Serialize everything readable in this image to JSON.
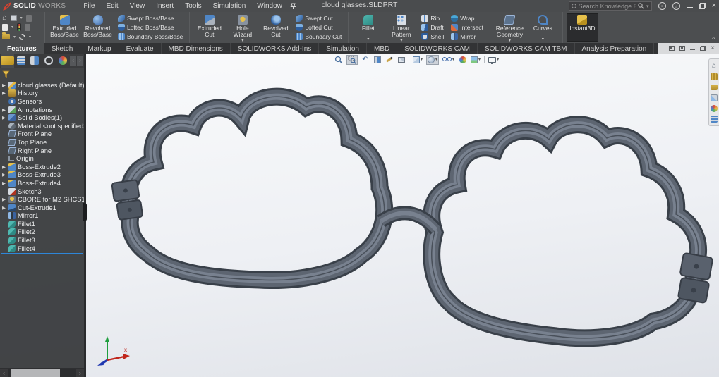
{
  "titlebar": {
    "brand": {
      "bold": "SOLID",
      "light": "WORKS",
      "logo_icon": "dassault-compass-icon"
    },
    "menus": [
      {
        "label": "File"
      },
      {
        "label": "Edit"
      },
      {
        "label": "View"
      },
      {
        "label": "Insert"
      },
      {
        "label": "Tools"
      },
      {
        "label": "Simulation"
      },
      {
        "label": "Window"
      }
    ],
    "pin_icon": "pin-icon",
    "document_title": "cloud glasses.SLDPRT",
    "search": {
      "placeholder": "Search Knowledge Base",
      "icons": [
        "knowledge-base-icon",
        "search-icon",
        "chevron-down-icon"
      ]
    },
    "window_icons": [
      "user-account-icon",
      "help-icon",
      "minimize-icon",
      "restore-icon",
      "close-icon"
    ],
    "help_glyph": "?"
  },
  "quick_access": {
    "icons": [
      "home-icon",
      "save-icon",
      "undo-icon",
      "redo-icon",
      "new-document-icon",
      "rebuild-icon",
      "open-document-icon",
      "options-icon"
    ]
  },
  "ribbon": {
    "collapse_glyph": "^",
    "groups": {
      "features_boss": {
        "big": [
          {
            "label": "Extruded Boss/Base",
            "icon": "b-boss"
          },
          {
            "label": "Revolved Boss/Base",
            "icon": "b-rev"
          }
        ],
        "small": [
          {
            "label": "Swept Boss/Base",
            "icon": "b-swept"
          },
          {
            "label": "Lofted Boss/Base",
            "icon": "b-loft"
          },
          {
            "label": "Boundary Boss/Base",
            "icon": "b-bound"
          }
        ]
      },
      "features_cut": {
        "big": [
          {
            "label": "Extruded Cut",
            "icon": "c-ext"
          },
          {
            "label": "Hole Wizard",
            "icon": "c-hole",
            "caret": "▾"
          },
          {
            "label": "Revolved Cut",
            "icon": "c-rev"
          }
        ],
        "small": [
          {
            "label": "Swept Cut",
            "icon": "b-swept"
          },
          {
            "label": "Lofted Cut",
            "icon": "b-loft"
          },
          {
            "label": "Boundary Cut",
            "icon": "b-bound"
          }
        ]
      },
      "modify": {
        "big": [
          {
            "label": "Fillet",
            "icon": "m-fil",
            "caret": "▾"
          },
          {
            "label": "Linear Pattern",
            "icon": "m-lp",
            "caret": "▾"
          }
        ],
        "small1": [
          {
            "label": "Rib",
            "icon": "m-rib"
          },
          {
            "label": "Draft",
            "icon": "m-draft"
          },
          {
            "label": "Shell",
            "icon": "m-shell"
          }
        ],
        "small2": [
          {
            "label": "Wrap",
            "icon": "m-wrap"
          },
          {
            "label": "Intersect",
            "icon": "m-int"
          },
          {
            "label": "Mirror",
            "icon": "m-mir"
          }
        ]
      },
      "reference": {
        "big": [
          {
            "label": "Reference Geometry",
            "icon": "r-ref",
            "caret": "▾"
          },
          {
            "label": "Curves",
            "icon": "r-crv",
            "caret": "▾"
          }
        ]
      },
      "instant3d": {
        "big": [
          {
            "label": "Instant3D",
            "icon": "i3d",
            "active": true
          }
        ]
      }
    }
  },
  "tabs": {
    "items": [
      {
        "label": "Features",
        "active": true
      },
      {
        "label": "Sketch"
      },
      {
        "label": "Markup"
      },
      {
        "label": "Evaluate"
      },
      {
        "label": "MBD Dimensions"
      },
      {
        "label": "SOLIDWORKS Add-Ins"
      },
      {
        "label": "Simulation"
      },
      {
        "label": "MBD"
      },
      {
        "label": "SOLIDWORKS CAM"
      },
      {
        "label": "SOLIDWORKS CAM TBM"
      },
      {
        "label": "Analysis Preparation"
      }
    ],
    "document_controls": [
      "cascade-icon",
      "tile-icon",
      "minimize-icon",
      "restore-icon",
      "close-icon"
    ]
  },
  "headsup": {
    "icons": [
      "zoom-to-fit-icon",
      "zoom-to-area-icon",
      "previous-view-icon",
      "section-view-icon",
      "dynamic-annotation-icon",
      "3d-drawing-view-icon",
      "view-orientation-icon",
      "display-style-icon",
      "hide-show-items-icon",
      "edit-appearance-icon",
      "apply-scene-icon",
      "view-settings-icon"
    ],
    "active_icon": "zoom-to-area-icon"
  },
  "feature_tree": {
    "header_icons": [
      "featuremanager-tree-icon",
      "propertymanager-icon",
      "configurationmanager-icon",
      "dimxpertmanager-icon",
      "displaymanager-icon",
      "scroll-left-icon",
      "scroll-right-icon"
    ],
    "filter_icon": "filter-icon",
    "root": {
      "label": "cloud glasses (Default) <<Default",
      "icon": "part"
    },
    "items": [
      {
        "label": "History",
        "icon": "folder",
        "expandable": true
      },
      {
        "label": "Sensors",
        "icon": "sensors"
      },
      {
        "label": "Annotations",
        "icon": "annotations",
        "expandable": true
      },
      {
        "label": "Solid Bodies(1)",
        "icon": "solids",
        "expandable": true
      },
      {
        "label": "Material <not specified>",
        "icon": "material"
      },
      {
        "label": "Front Plane",
        "icon": "plane"
      },
      {
        "label": "Top Plane",
        "icon": "plane"
      },
      {
        "label": "Right Plane",
        "icon": "plane"
      },
      {
        "label": "Origin",
        "icon": "origin"
      },
      {
        "label": "Boss-Extrude2",
        "icon": "extrude",
        "expandable": true
      },
      {
        "label": "Boss-Extrude3",
        "icon": "extrude",
        "expandable": true
      },
      {
        "label": "Boss-Extrude4",
        "icon": "extrude",
        "expandable": true
      },
      {
        "label": "Sketch3",
        "icon": "sketch"
      },
      {
        "label": "CBORE for M2 SHCS1",
        "icon": "hole",
        "expandable": true
      },
      {
        "label": "Cut-Extrude1",
        "icon": "cut",
        "expandable": true
      },
      {
        "label": "Mirror1",
        "icon": "mirror"
      },
      {
        "label": "Fillet1",
        "icon": "fillet"
      },
      {
        "label": "Fillet2",
        "icon": "fillet"
      },
      {
        "label": "Fillet3",
        "icon": "fillet"
      },
      {
        "label": "Fillet4",
        "icon": "fillet"
      }
    ],
    "rollback_color": "#2e86d8",
    "scrollbar": {
      "left_glyph": "‹",
      "right_glyph": "›"
    }
  },
  "task_pane": {
    "icons": [
      "solidworks-resources-icon",
      "design-library-icon",
      "file-explorer-icon",
      "view-palette-icon",
      "appearances-scenes-icon",
      "custom-properties-icon"
    ]
  },
  "viewport": {
    "model": "cloud-shaped eyeglasses frame, shaded gray, two cloud lenses joined by bridge with hinges at outer edges",
    "triad": {
      "x_label": "x",
      "x_color": "#c0261c",
      "y_color": "#1f9e3e",
      "z_color": "#2038b0"
    }
  },
  "colors": {
    "titlebar_bg": "#4a4c4e",
    "ribbon_bg": "#4c4e50",
    "tabbar_bg": "#323335",
    "panel_bg": "#37393c",
    "viewport_top": "#fafbfc",
    "viewport_bottom": "#dfe2e8",
    "frame_face": "#5d6571",
    "frame_edge": "#394049",
    "frame_highlight": "#78818f",
    "accent_blue": "#2e86d8"
  }
}
